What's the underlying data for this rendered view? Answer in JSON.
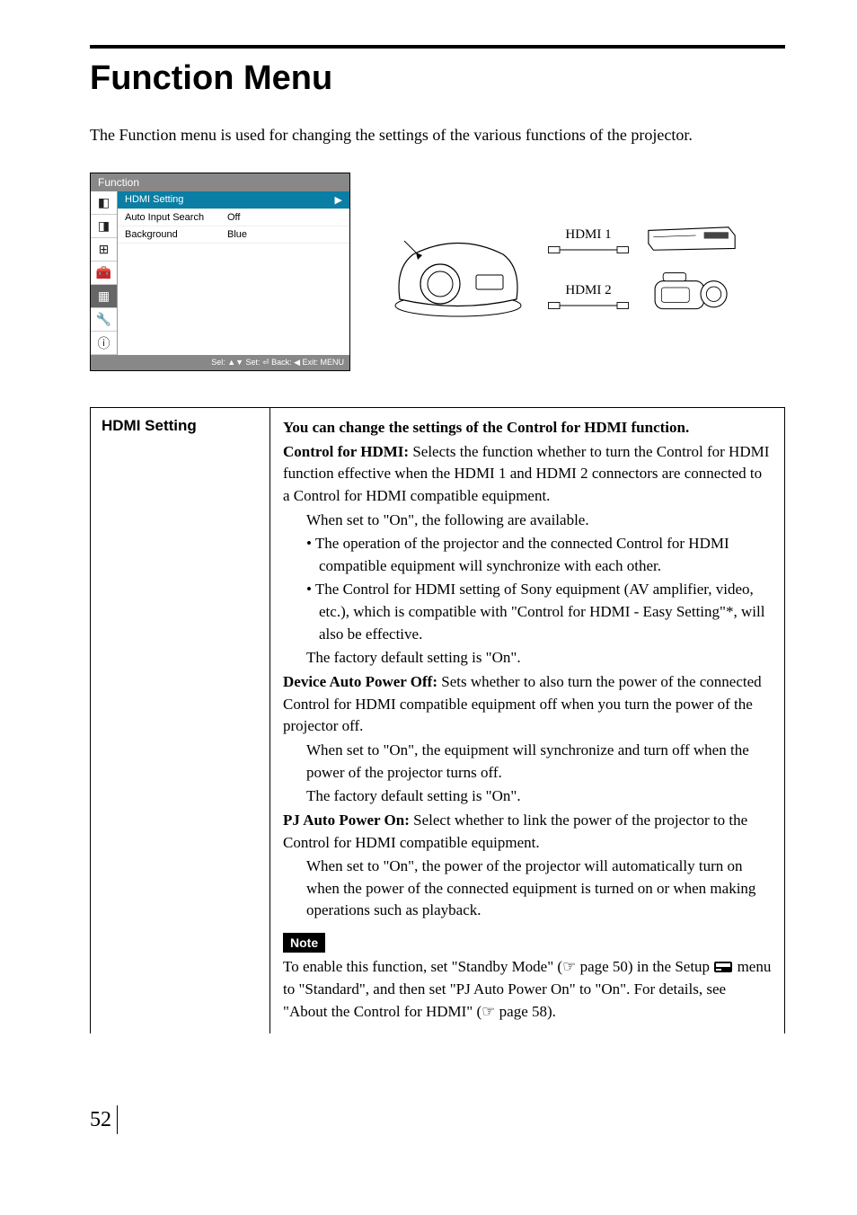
{
  "page": {
    "title": "Function Menu",
    "intro": "The Function menu is used for changing the settings of the various functions of the projector.",
    "number": "52"
  },
  "menu": {
    "title": "Function",
    "rows": [
      {
        "label": "HDMI Setting",
        "value": "",
        "selected": true,
        "arrow": "▶"
      },
      {
        "label": "Auto Input Search",
        "value": "Off",
        "selected": false,
        "arrow": ""
      },
      {
        "label": "Background",
        "value": "Blue",
        "selected": false,
        "arrow": ""
      }
    ],
    "footer": "Sel: ▲▼   Set: ⏎   Back: ◀   Exit: MENU",
    "sidebar_icons": [
      "◧",
      "◨",
      "⊞",
      "🧰",
      "▦",
      "🔧",
      "ⓘ"
    ]
  },
  "diagram": {
    "hdmi1": "HDMI 1",
    "hdmi2": "HDMI 2"
  },
  "spec": {
    "key": "HDMI Setting",
    "lead": "You can change the settings of the Control for HDMI function.",
    "cfh_label": "Control for HDMI:",
    "cfh_desc1": " Selects the function whether to turn the Control for HDMI function effective when the HDMI 1 and HDMI 2 connectors are connected to a Control for HDMI compatible equipment.",
    "cfh_on": "When set to \"On\", the following are available.",
    "cfh_b1": "• The operation of the projector and the connected Control for HDMI compatible equipment will synchronize with each other.",
    "cfh_b2": "• The Control for HDMI setting of Sony equipment (AV amplifier, video, etc.), which is compatible with \"Control for HDMI - Easy Setting\"*, will also be effective.",
    "cfh_default": "The factory default setting is \"On\".",
    "dapo_label": "Device Auto Power Off:",
    "dapo_desc": " Sets whether to also turn the power of the connected Control for HDMI compatible equipment off when you turn the power of the projector off.",
    "dapo_on": "When set to \"On\", the equipment will synchronize and turn off when the power of the projector turns off.",
    "dapo_default": "The factory default setting is \"On\".",
    "pjapo_label": "PJ Auto Power On:",
    "pjapo_desc": " Select whether to link the power of the projector to the Control for HDMI compatible equipment.",
    "pjapo_on": "When set to \"On\", the power of the projector will automatically turn on when the power of the connected equipment is turned on or when making operations such as playback.",
    "note_label": "Note",
    "note_body_pre": "To enable this function, set \"Standby Mode\" (",
    "note_body_ref1": " page 50) in the Setup ",
    "note_body_mid": " menu to \"Standard\", and then set \"PJ Auto Power On\" to \"On\". For details, see \"About the Control for HDMI\" (",
    "note_body_ref2": " page 58)."
  }
}
